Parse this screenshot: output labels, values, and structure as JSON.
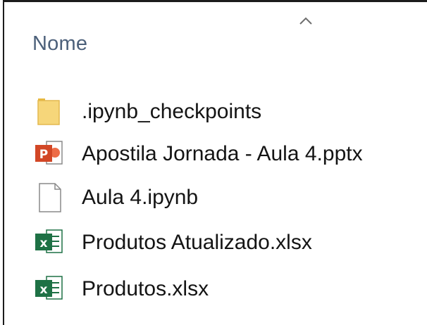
{
  "explorer": {
    "column_header": "Nome",
    "files": [
      {
        "name": ".ipynb_checkpoints",
        "icon": "folder-icon"
      },
      {
        "name": "Apostila Jornada - Aula 4.pptx",
        "icon": "powerpoint-file-icon"
      },
      {
        "name": "Aula 4.ipynb",
        "icon": "generic-file-icon"
      },
      {
        "name": "Produtos Atualizado.xlsx",
        "icon": "excel-file-icon"
      },
      {
        "name": "Produtos.xlsx",
        "icon": "excel-file-icon"
      }
    ]
  },
  "colors": {
    "header_text": "#4c607a",
    "folder": "#f6d67a",
    "powerpoint": "#d24726",
    "excel": "#1e7145"
  }
}
